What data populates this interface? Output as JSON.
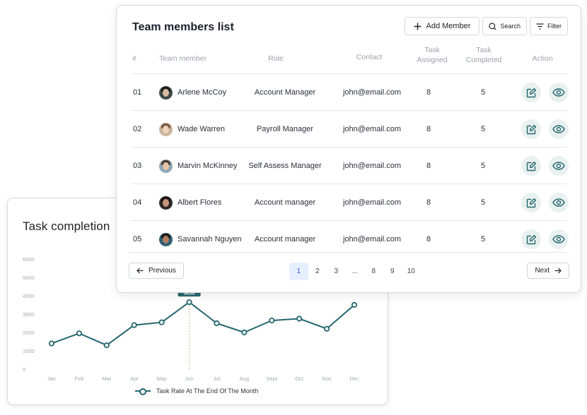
{
  "chart_card": {
    "title": "Task completion",
    "legend_label": "Task Rate At The End Of The Month"
  },
  "chart_data": {
    "type": "line",
    "title": "Task completion",
    "categories": [
      "Jan",
      "Feb",
      "Mar",
      "Apr",
      "May",
      "Jun",
      "Jul",
      "Aug",
      "Sept",
      "Oct",
      "Nov",
      "Dec"
    ],
    "series": [
      {
        "name": "Task Rate At The End Of The Month",
        "values": [
          1400,
          1950,
          1300,
          2400,
          2550,
          3650,
          2500,
          2000,
          2650,
          2750,
          2200,
          3500
        ]
      }
    ],
    "yticks": [
      "0",
      "1000",
      "2000",
      "3000",
      "4000",
      "5000",
      "6000"
    ],
    "ylim": [
      0,
      6000
    ],
    "grid": false,
    "highlight_index": 5,
    "line_color": "#24666e"
  },
  "table_card": {
    "title": "Team members list",
    "add_label": "Add Member",
    "search_label": "Search",
    "filter_label": "Filter",
    "columns": {
      "num": "#",
      "member": "Team member",
      "role": "Role",
      "contact": "Contact",
      "assigned": "Task Assigned",
      "completed": "Task Completed",
      "action": "Action"
    },
    "rows": [
      {
        "num": "01",
        "name": "Arlene McCoy",
        "role": "Account Manager",
        "contact": "john@email.com",
        "assigned": "8",
        "completed": "5"
      },
      {
        "num": "02",
        "name": "Wade Warren",
        "role": "Payroll Manager",
        "contact": "john@email.com",
        "assigned": "8",
        "completed": "5"
      },
      {
        "num": "03",
        "name": "Marvin McKinney",
        "role": "Self Assess Manager",
        "contact": "john@email.com",
        "assigned": "8",
        "completed": "5"
      },
      {
        "num": "04",
        "name": "Albert Flores",
        "role": "Account manager",
        "contact": "john@email.com",
        "assigned": "8",
        "completed": "5"
      },
      {
        "num": "05",
        "name": "Savannah Nguyen",
        "role": "Account manager",
        "contact": "john@email.com",
        "assigned": "8",
        "completed": "5"
      }
    ],
    "pagination": {
      "previous": "Previous",
      "next": "Next",
      "pages": [
        "1",
        "2",
        "3",
        "...",
        "8",
        "9",
        "10"
      ],
      "active_page": "1"
    }
  },
  "colors": {
    "accent": "#24666e",
    "action_bg": "#e8f1f0",
    "active_page_bg": "#e6efff"
  }
}
